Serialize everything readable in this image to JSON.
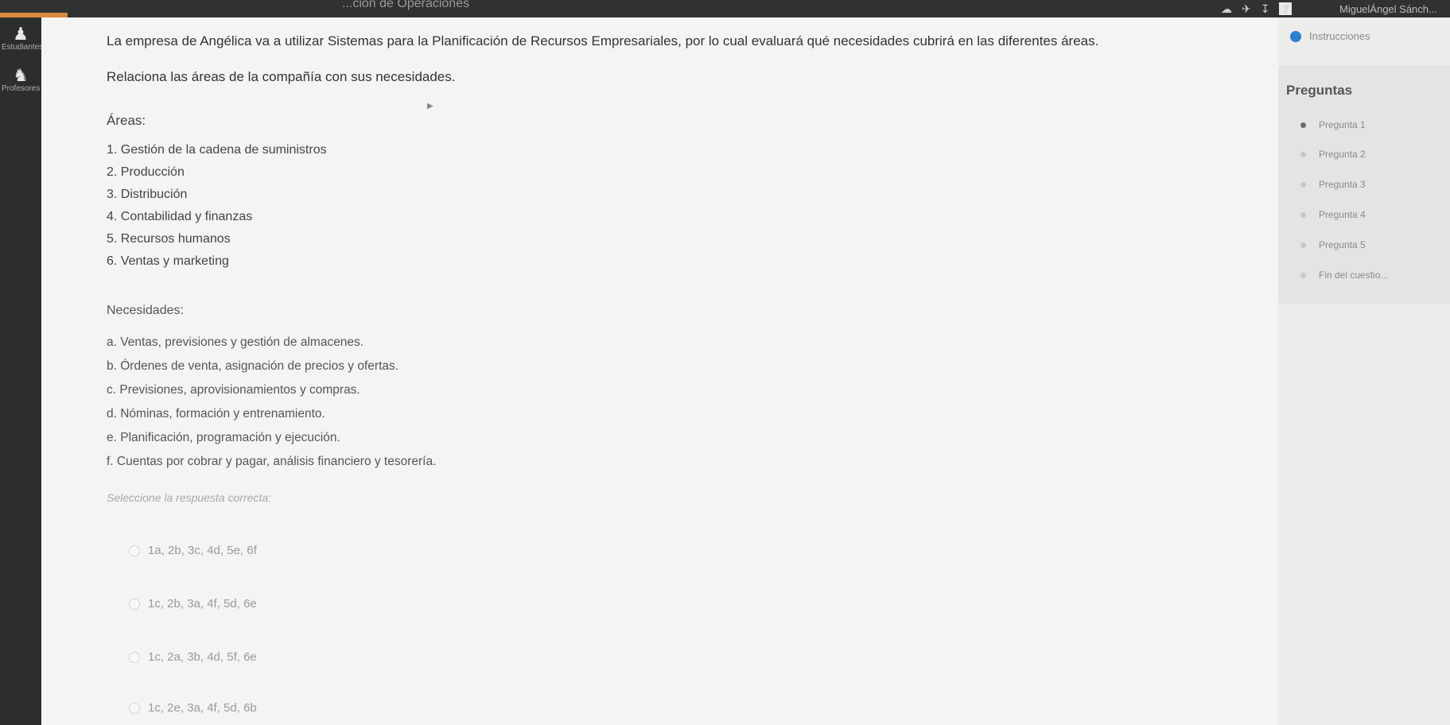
{
  "topbar": {
    "course_title": "...ción de Operaciones",
    "user_name": "MiguelÁngel Sánch...",
    "help_label": "?"
  },
  "sidebar": {
    "items": [
      {
        "icon": "person-icon",
        "label": "Estudiantes"
      },
      {
        "icon": "teacher-icon",
        "label": "Profesores"
      }
    ]
  },
  "question": {
    "intro": "La empresa de Angélica va a utilizar Sistemas para la Planificación de Recursos Empresariales, por lo cual evaluará qué necesidades cubrirá en las diferentes áreas.",
    "instruction": "Relaciona las áreas de la compañía con sus necesidades.",
    "areas_title": "Áreas:",
    "areas": [
      "1. Gestión de la cadena de suministros",
      "2. Producción",
      "3. Distribución",
      "4. Contabilidad y finanzas",
      "5. Recursos humanos",
      "6. Ventas y marketing"
    ],
    "needs_title": "Necesidades:",
    "needs": [
      "a. Ventas, previsiones y gestión de almacenes.",
      "b. Órdenes de venta, asignación de precios y ofertas.",
      "c. Previsiones, aprovisionamientos y compras.",
      "d. Nóminas, formación y entrenamiento.",
      "e. Planificación, programación y ejecución.",
      "f. Cuentas por cobrar y pagar, análisis financiero y tesorería."
    ],
    "prompt": "Seleccione la respuesta correcta:",
    "options": [
      "1a, 2b, 3c, 4d, 5e, 6f",
      "1c, 2b, 3a, 4f, 5d, 6e",
      "1c, 2a, 3b, 4d, 5f, 6e",
      "1c, 2e, 3a, 4f, 5d, 6b"
    ]
  },
  "rightpanel": {
    "instructions_label": "Instrucciones",
    "questions_title": "Preguntas",
    "questions": [
      {
        "label": "Pregunta 1",
        "active": true
      },
      {
        "label": "Pregunta 2",
        "active": false
      },
      {
        "label": "Pregunta 3",
        "active": false
      },
      {
        "label": "Pregunta 4",
        "active": false
      },
      {
        "label": "Pregunta 5",
        "active": false
      },
      {
        "label": "Fin del cuestio...",
        "active": false
      }
    ]
  }
}
